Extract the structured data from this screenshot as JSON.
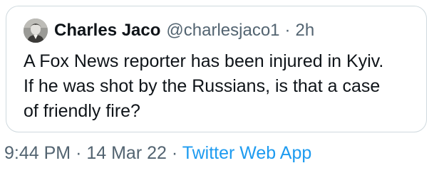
{
  "quoted_tweet": {
    "author_name": "Charles Jaco",
    "author_handle": "@charlesjaco1",
    "separator": "·",
    "time_ago": "2h",
    "text_lines": [
      "A Fox News reporter has been injured in Kyiv.",
      "If he was shot by the Russians, is that a case",
      "of friendly fire?"
    ],
    "avatar_icon": "profile-photo"
  },
  "tweet_meta": {
    "time": "9:44 PM",
    "separator": "·",
    "date": "14 Mar 22",
    "source": "Twitter Web App"
  },
  "colors": {
    "text_primary": "#0f1419",
    "text_secondary": "#536471",
    "link": "#1d9bf0",
    "border": "#cfd9de"
  }
}
